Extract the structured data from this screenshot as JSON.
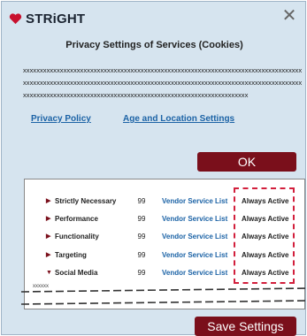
{
  "brand": {
    "name": "STRiGHT"
  },
  "dialog": {
    "title": "Privacy Settings of Services (Cookies)",
    "body": "xxxxxxxxxxxxxxxxxxxxxxxxxxxxxxxxxxxxxxxxxxxxxxxxxxxxxxxxxxxxxxxxxxxxxxxxxxxxxxxxxxxxxxxxxxxxxxxxxxxxxxxxxxxxxxxxxxxxxxxxxxxxxxxxxxxxxxxxxxxxxxxxxxxxxxxxxxxxxxxxxxxxxxxxxxxxxxxxxxxxxxxxxxxxxxxxxxxxxxxxxxxxxxxxxxxxxxxxxxxxxxxxxxxxxxxxx"
  },
  "links": {
    "privacy_policy": "Privacy Policy",
    "age_location": "Age and Location Settings"
  },
  "buttons": {
    "ok": "OK",
    "save": "Save Settings"
  },
  "categories": [
    {
      "label": "Strictly Necessary",
      "count": "99",
      "vendor": "Vendor Service List",
      "status": "Always Active",
      "expanded": false
    },
    {
      "label": "Performance",
      "count": "99",
      "vendor": "Vendor Service List",
      "status": "Always Active",
      "expanded": false
    },
    {
      "label": "Functionality",
      "count": "99",
      "vendor": "Vendor Service List",
      "status": "Always Active",
      "expanded": false
    },
    {
      "label": "Targeting",
      "count": "99",
      "vendor": "Vendor Service List",
      "status": "Always Active",
      "expanded": false
    },
    {
      "label": "Social Media",
      "count": "99",
      "vendor": "Vendor Service List",
      "status": "Always Active",
      "expanded": true
    }
  ],
  "social_media_note": "xxxxxx",
  "colors": {
    "accent": "#7a0f1b",
    "link": "#1c63a6",
    "highlight": "#d21f3c",
    "background": "#d6e4ef"
  },
  "icons": {
    "brand": "heart-icon",
    "close": "close-icon",
    "collapsed": "triangle-right-icon",
    "expanded": "triangle-down-icon"
  }
}
